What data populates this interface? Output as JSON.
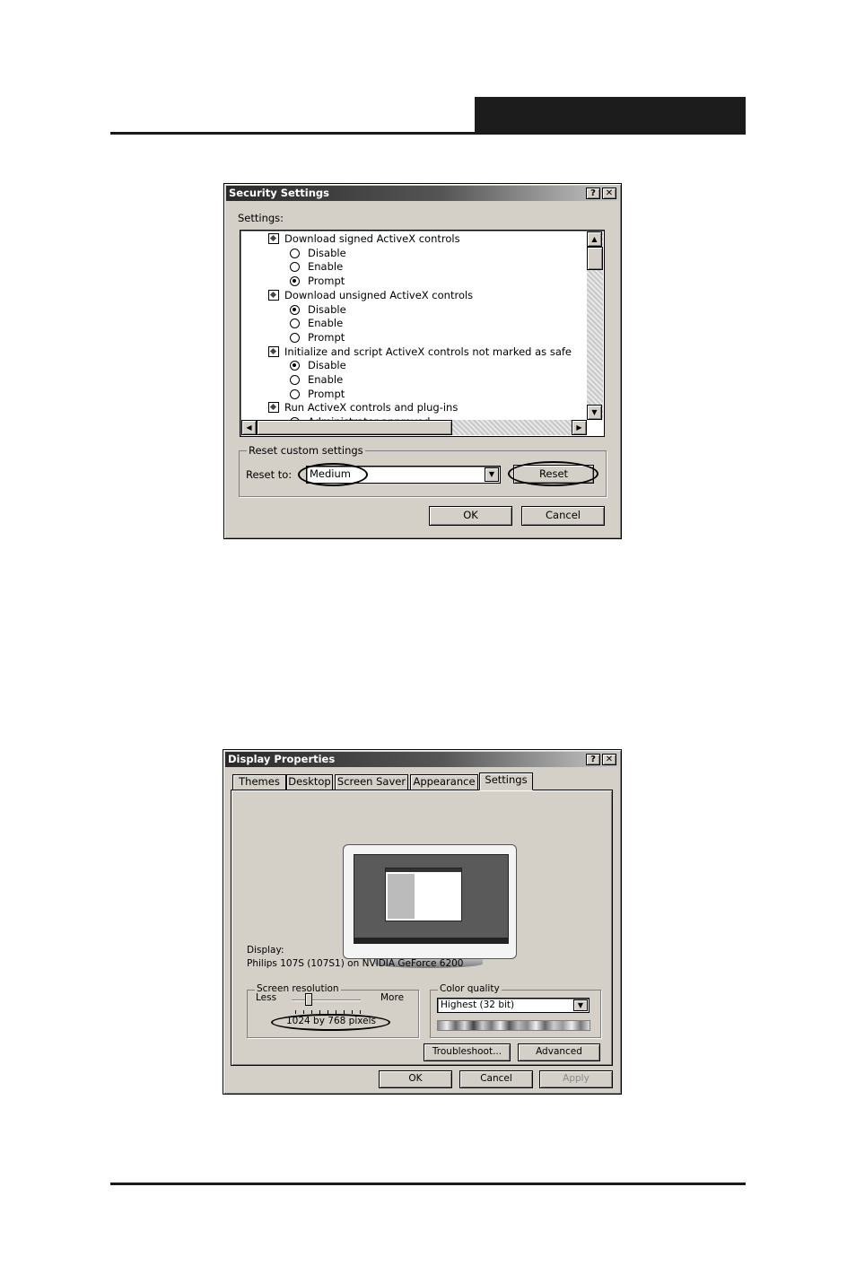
{
  "security": {
    "title": "Security Settings",
    "help_glyph": "?",
    "close_glyph": "✕",
    "settings_label": "Settings:",
    "items": [
      {
        "type": "category",
        "label": "Download signed ActiveX controls"
      },
      {
        "type": "option",
        "label": "Disable",
        "checked": false
      },
      {
        "type": "option",
        "label": "Enable",
        "checked": false
      },
      {
        "type": "option",
        "label": "Prompt",
        "checked": true
      },
      {
        "type": "category",
        "label": "Download unsigned ActiveX controls"
      },
      {
        "type": "option",
        "label": "Disable",
        "checked": true
      },
      {
        "type": "option",
        "label": "Enable",
        "checked": false
      },
      {
        "type": "option",
        "label": "Prompt",
        "checked": false
      },
      {
        "type": "category",
        "label": "Initialize and script ActiveX controls not marked as safe"
      },
      {
        "type": "option",
        "label": "Disable",
        "checked": true
      },
      {
        "type": "option",
        "label": "Enable",
        "checked": false
      },
      {
        "type": "option",
        "label": "Prompt",
        "checked": false
      },
      {
        "type": "category",
        "label": "Run ActiveX controls and plug-ins"
      },
      {
        "type": "option",
        "label": "Administrator approved",
        "checked": false
      }
    ],
    "reset_group_label": "Reset custom settings",
    "reset_to_label": "Reset to:",
    "reset_to_value": "Medium",
    "reset_button": "Reset",
    "ok_button": "OK",
    "cancel_button": "Cancel"
  },
  "display": {
    "title": "Display Properties",
    "help_glyph": "?",
    "close_glyph": "✕",
    "tabs": [
      {
        "label": "Themes",
        "active": false
      },
      {
        "label": "Desktop",
        "active": false
      },
      {
        "label": "Screen Saver",
        "active": false
      },
      {
        "label": "Appearance",
        "active": false
      },
      {
        "label": "Settings",
        "active": true
      }
    ],
    "display_label": "Display:",
    "display_value": "Philips 107S (107S1) on NVIDIA GeForce 6200",
    "resolution_group_label": "Screen resolution",
    "less_label": "Less",
    "more_label": "More",
    "resolution_value": "1024 by 768 pixels",
    "slider_level": 0.25,
    "color_group_label": "Color quality",
    "color_value": "Highest (32 bit)",
    "troubleshoot_button": "Troubleshoot...",
    "advanced_button": "Advanced",
    "ok_button": "OK",
    "cancel_button": "Cancel",
    "apply_button": "Apply"
  }
}
